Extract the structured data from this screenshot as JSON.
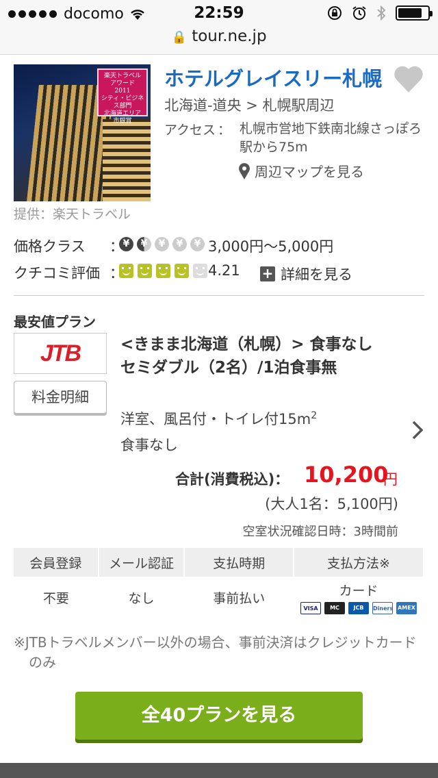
{
  "status_bar": {
    "carrier": "docomo",
    "time": "22:59"
  },
  "browser": {
    "url": "tour.ne.jp"
  },
  "hotel": {
    "name": "ホテルグレイスリー札幌",
    "area": "北海道-道央 > 札幌駅周辺",
    "access_label": "アクセス",
    "access_colon": "：",
    "access_text": "札幌市営地下鉄南北線さっぽろ駅から75m",
    "map_link": "周辺マップを見る",
    "image_caption": "提供：楽天トラベル",
    "award_text": "楽天トラベル アワード 2011 シティ・ビジネス部門 北海道エリア 市銀賞"
  },
  "price_class": {
    "label": "価格クラス",
    "colon": "：",
    "yen_glyph": "¥",
    "level": 1.5,
    "max": 5,
    "range": "3,000円～5,000円"
  },
  "review": {
    "label": "クチコミ評価",
    "colon": "：",
    "score": "4.21",
    "faces_on": 4,
    "faces_max": 5,
    "detail_link": "詳細を見る",
    "detail_icon": "plus-icon"
  },
  "plan": {
    "section_label": "最安値プラン",
    "provider_logo": "JTB",
    "fee_button": "料金明細",
    "title": "<きまま北海道（札幌）> 食事なし　セミダブル（2名）/1泊食事無",
    "room_prefix": "洋室、風呂付・トイレ付15m",
    "room_sup": "2",
    "meal": "食事なし",
    "total_label": "合計(消費税込)：",
    "total_price": "10,200",
    "total_unit": "円",
    "per_person": "(大人1名：5,100円)",
    "checked_time": "空室状況確認日時：3時間前"
  },
  "conditions": {
    "headers": [
      "会員登録",
      "メール認証",
      "支払時期",
      "支払方法※"
    ],
    "values": [
      "不要",
      "なし",
      "事前払い",
      "カード"
    ],
    "cards": [
      "VISA",
      "MC",
      "JCB",
      "Diners",
      "AMEX"
    ]
  },
  "note": "※JTBトラベルメンバー以外の場合、事前決済はクレジットカードのみ",
  "cta": "全40プランを見る",
  "colors": {
    "link": "#1a6ac0",
    "price": "#e5141f",
    "cta": "#7aae1a",
    "review_face": "#b9c224"
  }
}
